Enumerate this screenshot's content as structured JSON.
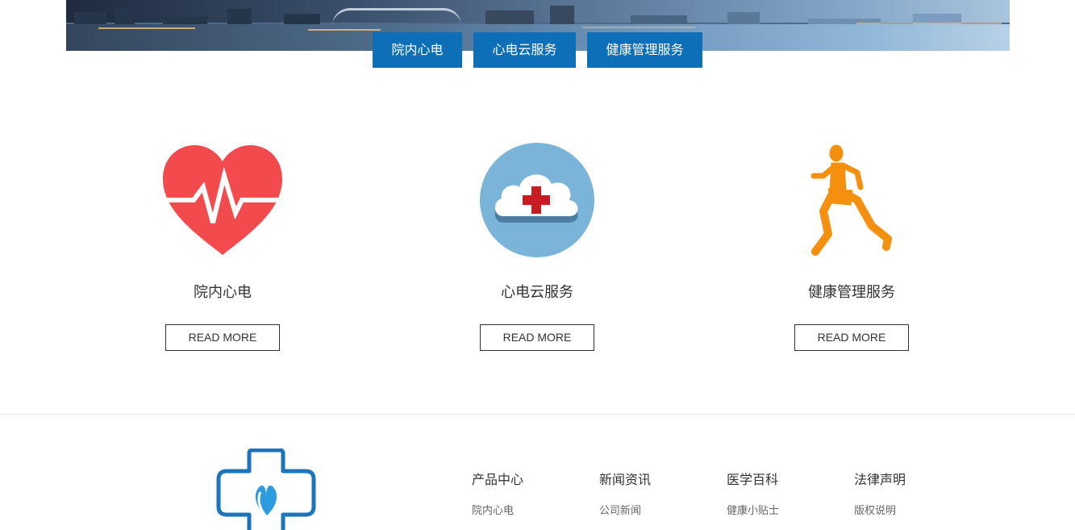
{
  "tabs": [
    {
      "label": "院内心电"
    },
    {
      "label": "心电云服务"
    },
    {
      "label": "健康管理服务"
    }
  ],
  "services": [
    {
      "title": "院内心电",
      "button": "READ MORE",
      "icon": "heart-pulse-icon"
    },
    {
      "title": "心电云服务",
      "button": "READ MORE",
      "icon": "cloud-cross-icon"
    },
    {
      "title": "健康管理服务",
      "button": "READ MORE",
      "icon": "runner-icon"
    }
  ],
  "footer": {
    "logo": "medical-cross-logo",
    "columns": [
      {
        "heading": "产品中心",
        "links": [
          "院内心电"
        ]
      },
      {
        "heading": "新闻资讯",
        "links": [
          "公司新闻"
        ]
      },
      {
        "heading": "医学百科",
        "links": [
          "健康小贴士"
        ]
      },
      {
        "heading": "法律声明",
        "links": [
          "版权说明"
        ]
      }
    ]
  },
  "colors": {
    "accent": "#0d6fb8",
    "heart": "#f24a4d",
    "cloud_circle": "#7ab4d9",
    "cross": "#c71c22",
    "runner": "#f5900f"
  }
}
